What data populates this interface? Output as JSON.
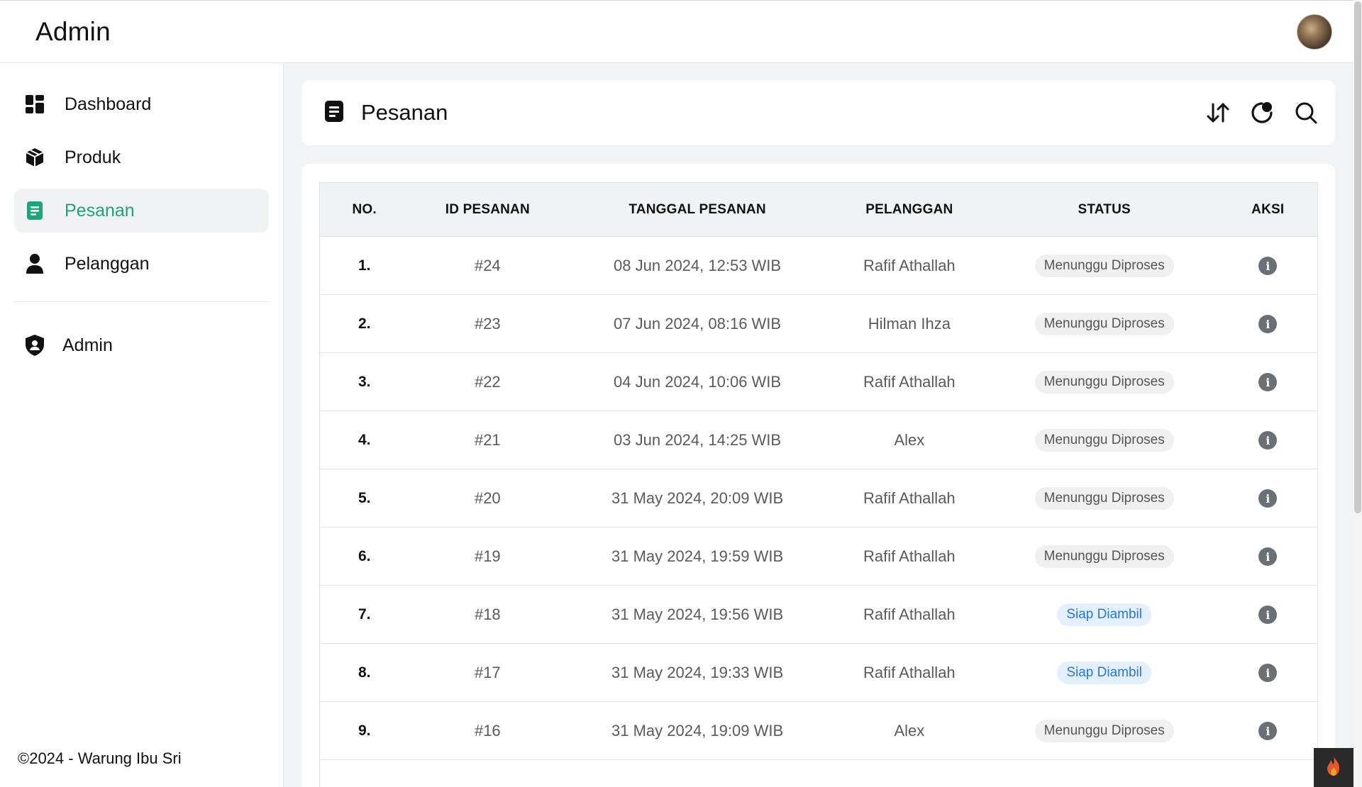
{
  "app": {
    "brand": "Admin"
  },
  "sidebar": {
    "items": [
      {
        "label": "Dashboard",
        "icon": "dashboard-icon",
        "active": false
      },
      {
        "label": "Produk",
        "icon": "box-icon",
        "active": false
      },
      {
        "label": "Pesanan",
        "icon": "document-icon",
        "active": true
      },
      {
        "label": "Pelanggan",
        "icon": "user-icon",
        "active": false
      }
    ],
    "admin_item": {
      "label": "Admin",
      "icon": "shield-icon"
    },
    "footer": "©2024 - Warung Ibu Sri"
  },
  "page": {
    "title": "Pesanan",
    "actions": [
      "sort-icon",
      "refresh-icon",
      "search-icon"
    ]
  },
  "table": {
    "headers": [
      "NO.",
      "ID PESANAN",
      "TANGGAL PESANAN",
      "PELANGGAN",
      "STATUS",
      "AKSI"
    ],
    "rows": [
      {
        "no": "1.",
        "id": "#24",
        "date": "08 Jun 2024, 12:53 WIB",
        "customer": "Rafif Athallah",
        "status": "Menunggu Diproses",
        "status_type": "wait"
      },
      {
        "no": "2.",
        "id": "#23",
        "date": "07 Jun 2024, 08:16 WIB",
        "customer": "Hilman Ihza",
        "status": "Menunggu Diproses",
        "status_type": "wait"
      },
      {
        "no": "3.",
        "id": "#22",
        "date": "04 Jun 2024, 10:06 WIB",
        "customer": "Rafif Athallah",
        "status": "Menunggu Diproses",
        "status_type": "wait"
      },
      {
        "no": "4.",
        "id": "#21",
        "date": "03 Jun 2024, 14:25 WIB",
        "customer": "Alex",
        "status": "Menunggu Diproses",
        "status_type": "wait"
      },
      {
        "no": "5.",
        "id": "#20",
        "date": "31 May 2024, 20:09 WIB",
        "customer": "Rafif Athallah",
        "status": "Menunggu Diproses",
        "status_type": "wait"
      },
      {
        "no": "6.",
        "id": "#19",
        "date": "31 May 2024, 19:59 WIB",
        "customer": "Rafif Athallah",
        "status": "Menunggu Diproses",
        "status_type": "wait"
      },
      {
        "no": "7.",
        "id": "#18",
        "date": "31 May 2024, 19:56 WIB",
        "customer": "Rafif Athallah",
        "status": "Siap Diambil",
        "status_type": "ready"
      },
      {
        "no": "8.",
        "id": "#17",
        "date": "31 May 2024, 19:33 WIB",
        "customer": "Rafif Athallah",
        "status": "Siap Diambil",
        "status_type": "ready"
      },
      {
        "no": "9.",
        "id": "#16",
        "date": "31 May 2024, 19:09 WIB",
        "customer": "Alex",
        "status": "Menunggu Diproses",
        "status_type": "wait"
      }
    ],
    "info_glyph": "i"
  },
  "colors": {
    "accent": "#1aa57a",
    "badge_ready_text": "#2a78d6",
    "badge_ready_bg": "#e3f0ff",
    "badge_wait_bg": "#f0f0f0"
  }
}
